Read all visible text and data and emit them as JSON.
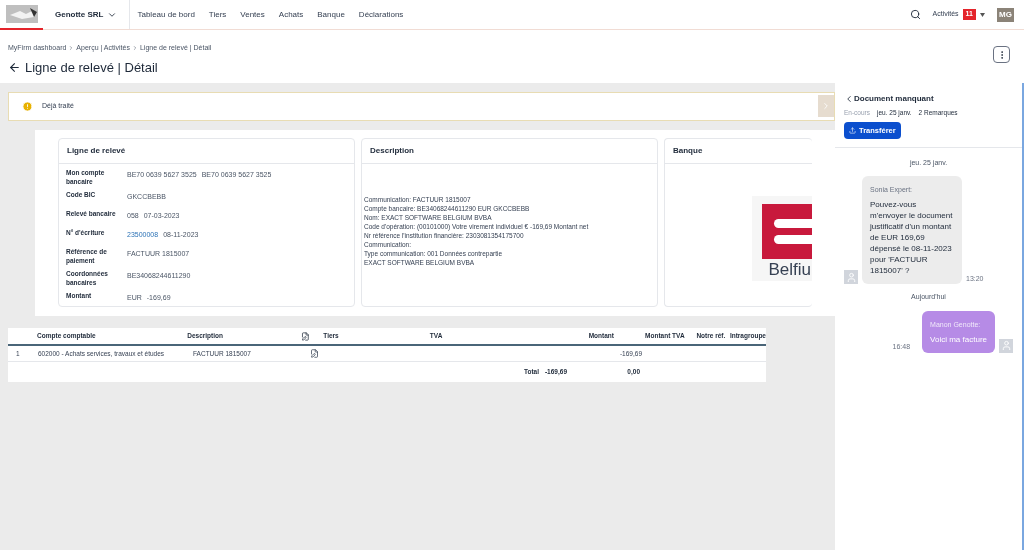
{
  "nav": {
    "company": "Genotte SRL",
    "items": [
      {
        "label": "Tableau de bord",
        "selected": false
      },
      {
        "label": "Tiers",
        "selected": false
      },
      {
        "label": "Ventes",
        "selected": false
      },
      {
        "label": "Achats",
        "selected": false
      },
      {
        "label": "Banque",
        "selected": false
      },
      {
        "label": "Déclarations",
        "selected": false
      }
    ],
    "activities": "Activités",
    "activities_count": "11",
    "avatar": "MG"
  },
  "breadcrumb": [
    "MyFirm dashboard",
    "Aperçu | Activités",
    "Ligne de relevé | Détail"
  ],
  "title": "Ligne de relevé | Détail",
  "alert": "Déjà traité",
  "statement": {
    "title": "Ligne de relevé",
    "fields": [
      {
        "label": "Mon compte bancaire",
        "values": [
          "BE70 0639 5627 3525",
          "BE70 0639 5627 3525"
        ]
      },
      {
        "label": "Code BIC",
        "values": [
          "GKCCBEBB"
        ]
      },
      {
        "label": "Relevé bancaire",
        "values": [
          "058",
          "07-03-2023"
        ]
      },
      {
        "label": "N° d'écriture",
        "values": [
          "23500008",
          "08-11-2023"
        ],
        "link": true
      },
      {
        "label": "Référence de paiement",
        "values": [
          "FACTUUR 1815007"
        ]
      },
      {
        "label": "Coordonnées bancaires",
        "values": [
          "BE34068244611290"
        ]
      },
      {
        "label": "Montant",
        "values": [
          "EUR",
          "-169,69"
        ]
      }
    ]
  },
  "description": {
    "title": "Description",
    "lines": [
      "Communication: FACTUUR 1815007",
      "Compte bancaire: BE34068244611290 EUR GKCCBEBB",
      "Nom: EXACT SOFTWARE BELGIUM BVBA",
      "Code d'opération: (00101000) Votre virement individuel € -169,69 Montant net",
      "Nr référence l'institution financière: 2303081354175700",
      "Communication:",
      "Type communication: 001 Données contrepartie",
      "EXACT SOFTWARE BELGIUM BVBA"
    ]
  },
  "bank": {
    "title": "Banque",
    "logo_text": "Belfiu"
  },
  "table": {
    "columns": [
      "Compte comptable",
      "Description",
      "Tiers",
      "TVA",
      "Montant",
      "Montant TVA",
      "Notre réf.",
      "Intragroupe"
    ],
    "rows": [
      {
        "index": "1",
        "account": "602000 - Achats services, travaux et études",
        "description": "FACTUUR 1815007",
        "amount": "-169,69"
      }
    ],
    "total_label": "Total",
    "total_amount": "-169,69",
    "total_vat": "0,00"
  },
  "panel": {
    "title": "Document manquant",
    "status": "En-cours",
    "date": "jeu. 25 janv.",
    "remarks": "2 Remarques",
    "button": "Transférer",
    "messages": [
      {
        "kind": "divider",
        "text": "jeu. 25 janv."
      },
      {
        "kind": "incoming",
        "author": "Sonia Expert:",
        "text": "Pouvez-vous m'envoyer le document justificatif d'un montant de EUR 169,69 dépensé le 08-11-2023 pour 'FACTUUR 1815007' ?",
        "time": "13:20"
      },
      {
        "kind": "divider",
        "text": "Aujourd'hui"
      },
      {
        "kind": "outgoing",
        "author": "Manon Genotte:",
        "text": "Voici ma facture",
        "time": "16:48"
      }
    ]
  }
}
